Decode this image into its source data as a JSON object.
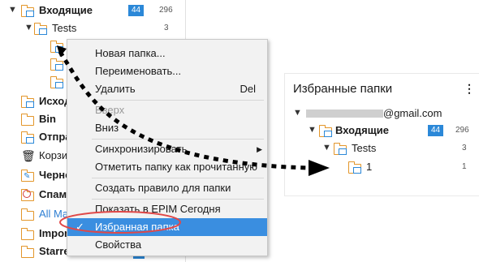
{
  "tree": {
    "inbox_label": "Входящие",
    "inbox_unread": "44",
    "inbox_total": "296",
    "tests_label": "Tests",
    "tests_total": "3",
    "items": [
      {
        "label": "Исход",
        "style": "bold"
      },
      {
        "label": "Bin",
        "style": "bold"
      },
      {
        "label": "Отпра",
        "style": "bold"
      },
      {
        "label": "Корзи",
        "style": "normal"
      },
      {
        "label": "Черно",
        "style": "bold"
      },
      {
        "label": "Спам",
        "style": "bold"
      },
      {
        "label": "All Ma",
        "style": "blue"
      },
      {
        "label": "Impor",
        "style": "bold"
      },
      {
        "label": "Starred",
        "style": "bold"
      }
    ],
    "starred_count_1": "1",
    "starred_count_2": "2"
  },
  "menu": {
    "new_folder": "Новая папка...",
    "rename": "Переименовать...",
    "delete": "Удалить",
    "delete_shortcut": "Del",
    "up": "Вверх",
    "down": "Вниз",
    "sync": "Синхронизировать",
    "mark_read": "Отметить папку как прочитанную",
    "create_rule": "Создать правило для папки",
    "show_today": "Показать в EPIM Сегодня",
    "favorite": "Избранная папка",
    "favorite_check": "✓",
    "properties": "Свойства"
  },
  "favorites": {
    "title": "Избранные папки",
    "menu_icon": "⋮",
    "account": "@gmail.com",
    "inbox_label": "Входящие",
    "inbox_unread": "44",
    "inbox_total": "296",
    "tests_label": "Tests",
    "tests_total": "3",
    "sub_label": "1",
    "sub_total": "1"
  },
  "colors": {
    "accent": "#2b88d8",
    "folder": "#e3962a",
    "selection": "#3a8ee0",
    "annotation_red": "#e04848"
  }
}
